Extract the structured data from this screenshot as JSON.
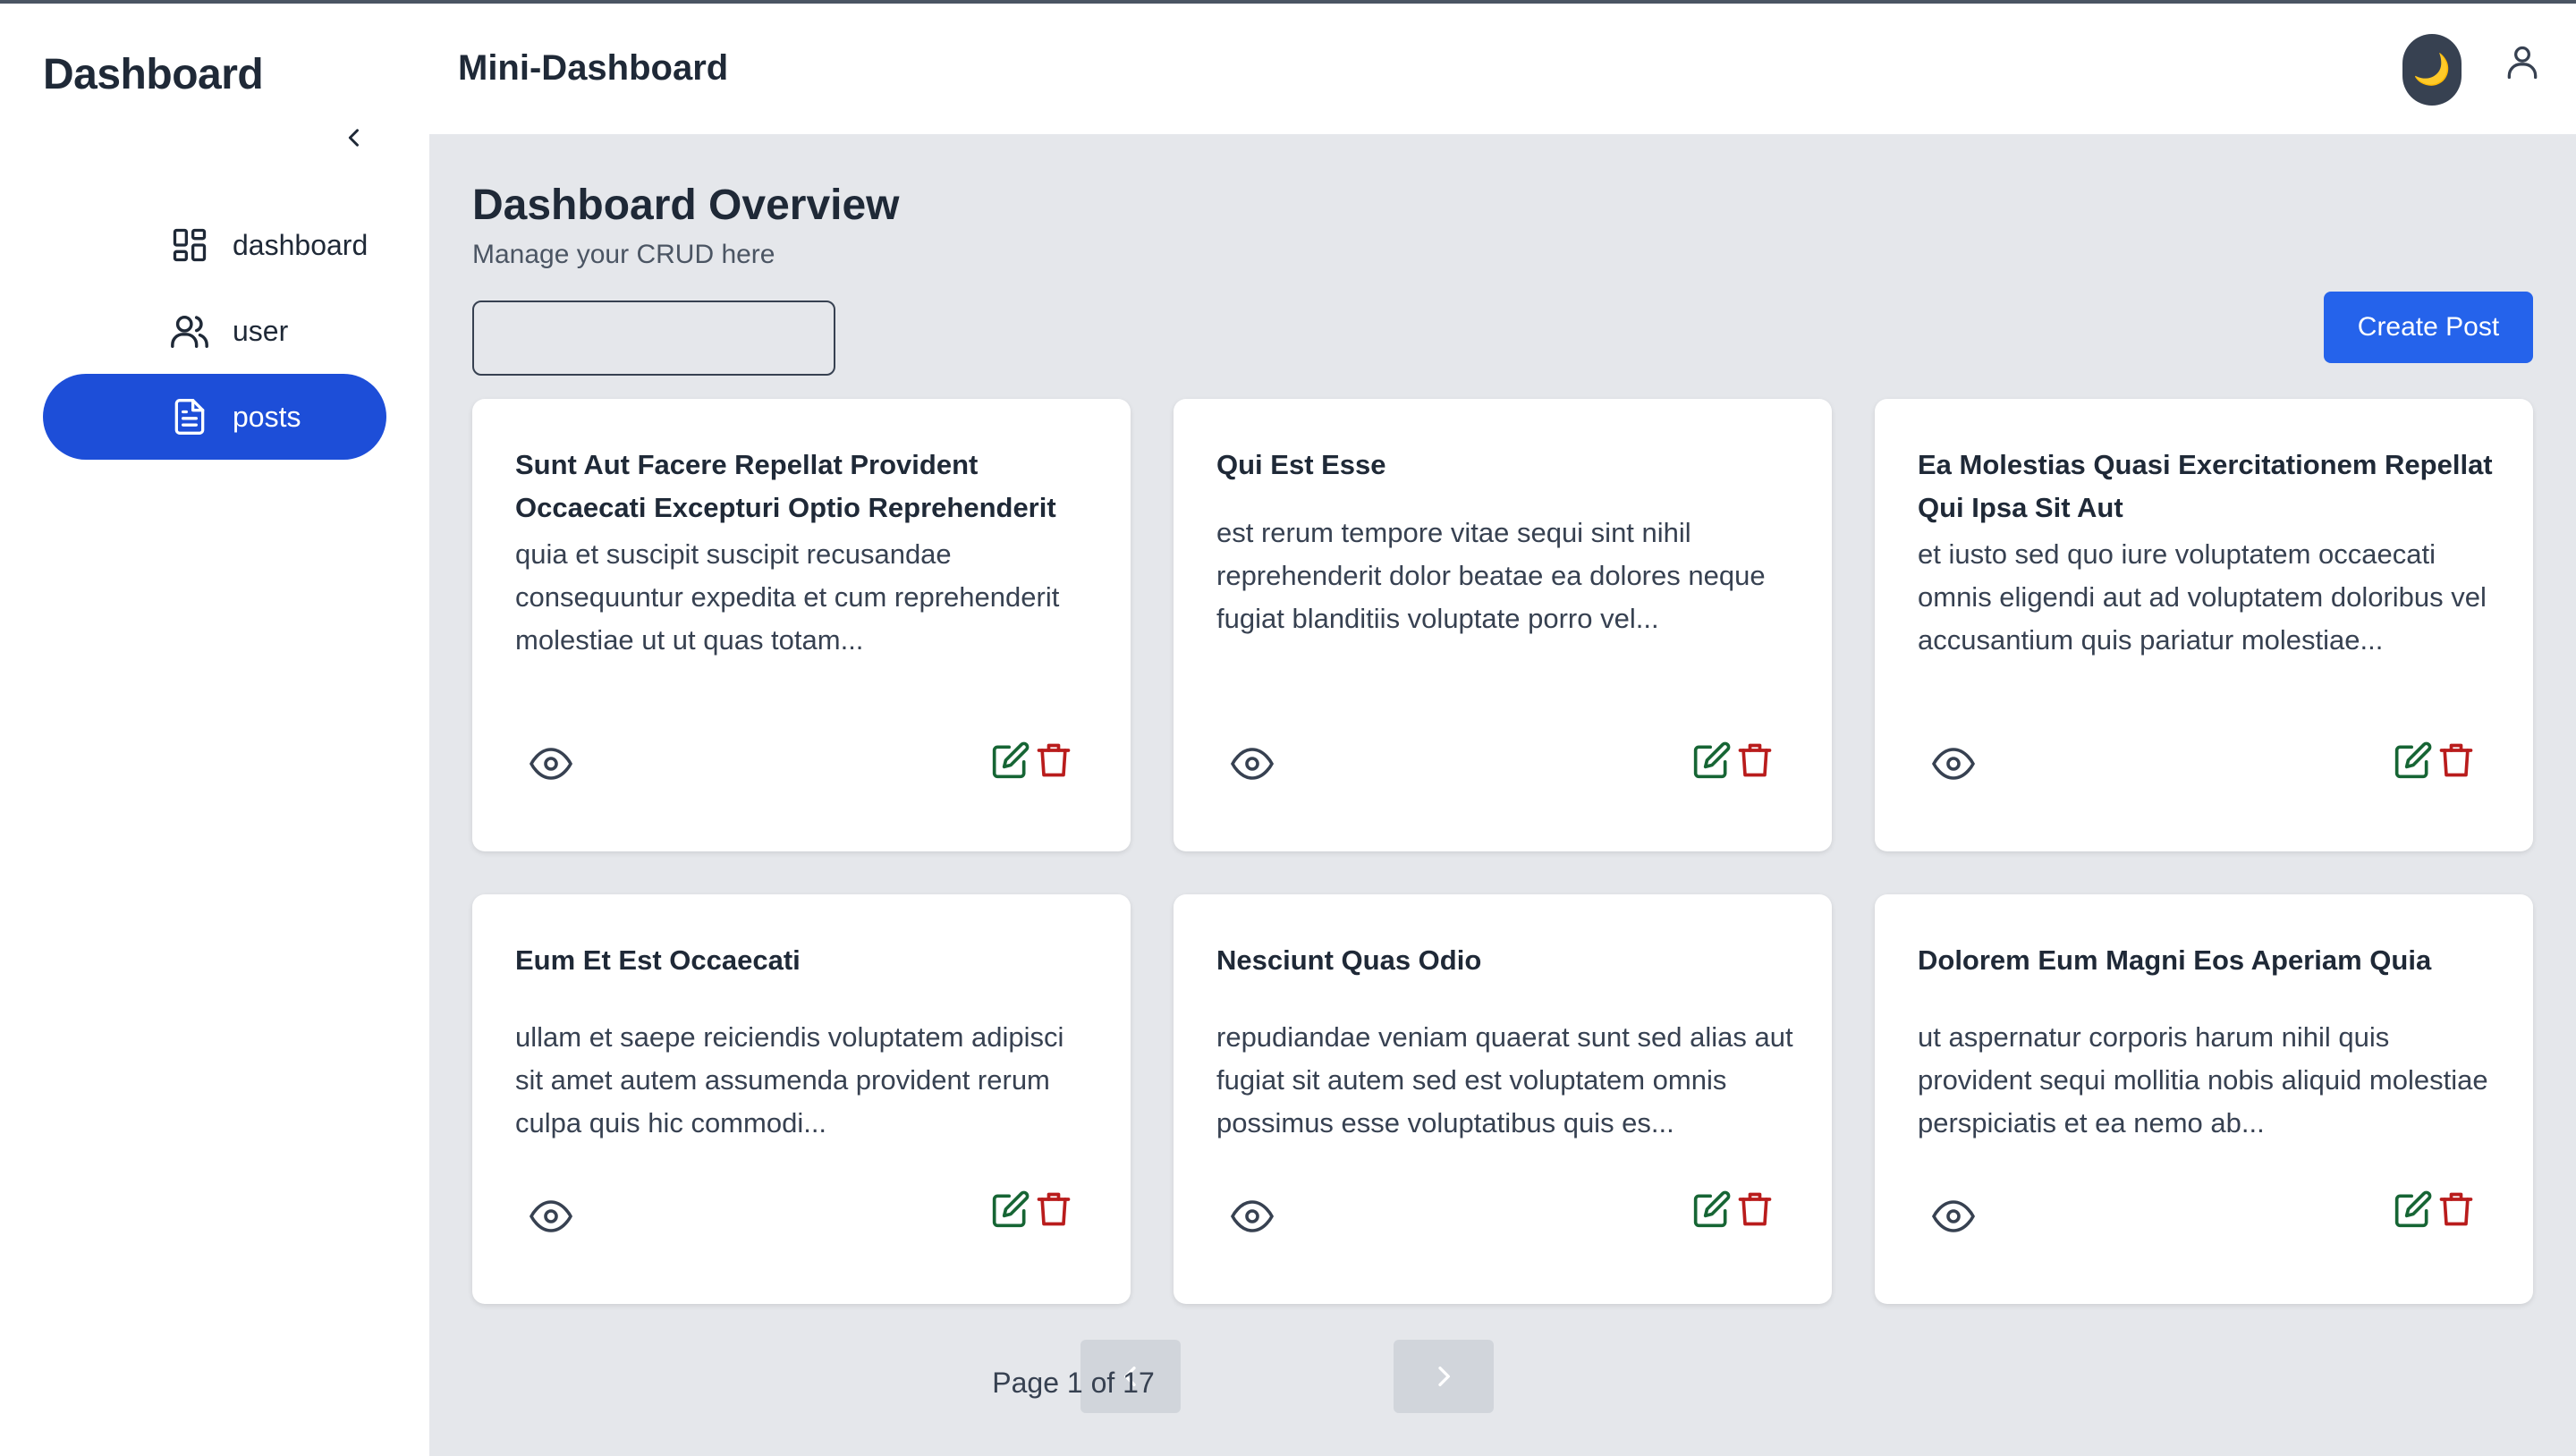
{
  "sidebar": {
    "title": "Dashboard",
    "items": [
      {
        "label": "dashboard",
        "icon": "grid-icon",
        "active": false
      },
      {
        "label": "user",
        "icon": "users-icon",
        "active": false
      },
      {
        "label": "posts",
        "icon": "document-icon",
        "active": true
      }
    ]
  },
  "header": {
    "app_title": "Mini-Dashboard",
    "theme_icon": "🌙"
  },
  "main": {
    "title": "Dashboard Overview",
    "subtitle": "Manage your CRUD here",
    "search": {
      "value": "",
      "placeholder": ""
    },
    "create_label": "Create Post"
  },
  "posts": [
    {
      "title": "Sunt Aut Facere Repellat Provident Occaecati Excepturi Optio Reprehenderit",
      "body": "quia et suscipit suscipit recusandae consequuntur expedita et cum reprehenderit molestiae ut ut quas totam..."
    },
    {
      "title": "Qui Est Esse",
      "body": "est rerum tempore vitae sequi sint nihil reprehenderit dolor beatae ea dolores neque fugiat blanditiis voluptate porro vel..."
    },
    {
      "title": "Ea Molestias Quasi Exercitationem Repellat Qui Ipsa Sit Aut",
      "body": "et iusto sed quo iure voluptatem occaecati omnis eligendi aut ad voluptatem doloribus vel accusantium quis pariatur molestiae..."
    },
    {
      "title": "Eum Et Est Occaecati",
      "body": "ullam et saepe reiciendis voluptatem adipisci sit amet autem assumenda provident rerum culpa quis hic commodi..."
    },
    {
      "title": "Nesciunt Quas Odio",
      "body": "repudiandae veniam quaerat sunt sed alias aut fugiat sit autem sed est voluptatem omnis possimus esse voluptatibus quis es..."
    },
    {
      "title": "Dolorem Eum Magni Eos Aperiam Quia",
      "body": "ut aspernatur corporis harum nihil quis provident sequi mollitia nobis aliquid molestiae perspiciatis et ea nemo ab..."
    }
  ],
  "pagination": {
    "label": "Page 1 of 17"
  },
  "colors": {
    "primary": "#1d4ed8",
    "button": "#2563eb",
    "edit": "#166534",
    "delete": "#b91c1c",
    "background": "#e5e7eb"
  }
}
